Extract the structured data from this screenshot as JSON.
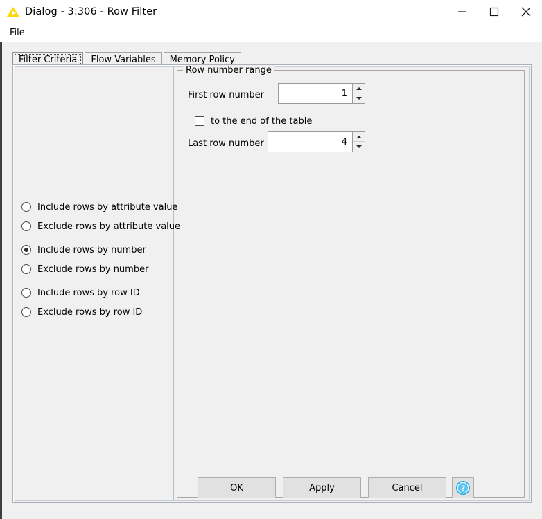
{
  "window": {
    "title": "Dialog - 3:306 - Row Filter",
    "app_icon": "knime-node-triangle-icon",
    "controls": {
      "minimize": "minimize-icon",
      "maximize": "maximize-icon",
      "close": "close-icon"
    }
  },
  "menubar": {
    "items": [
      {
        "label": "File"
      }
    ]
  },
  "tabs": [
    {
      "label": "Filter Criteria",
      "active": true
    },
    {
      "label": "Flow Variables",
      "active": false
    },
    {
      "label": "Memory Policy",
      "active": false
    }
  ],
  "filter_criteria": {
    "radio_options": [
      {
        "label": "Include rows by attribute value",
        "selected": false
      },
      {
        "label": "Exclude rows by attribute value",
        "selected": false
      },
      {
        "label": "Include rows by number",
        "selected": true
      },
      {
        "label": "Exclude rows by number",
        "selected": false
      },
      {
        "label": "Include rows by row ID",
        "selected": false
      },
      {
        "label": "Exclude rows by row ID",
        "selected": false
      }
    ],
    "row_number_range": {
      "title": "Row number range",
      "first_row_label": "First row number",
      "first_row_value": "1",
      "to_end_checkbox_label": "to the end of the table",
      "to_end_checked": false,
      "last_row_label": "Last row number",
      "last_row_value": "4"
    }
  },
  "footer": {
    "ok_label": "OK",
    "apply_label": "Apply",
    "cancel_label": "Cancel",
    "help_icon": "help-question-icon"
  },
  "colors": {
    "dialog_background": "#f0f0f0",
    "titlebar_background": "#ffffff",
    "knime_yellow": "#ffd800",
    "help_blue": "#29a8e0",
    "border_gray": "#a8a8a8"
  }
}
